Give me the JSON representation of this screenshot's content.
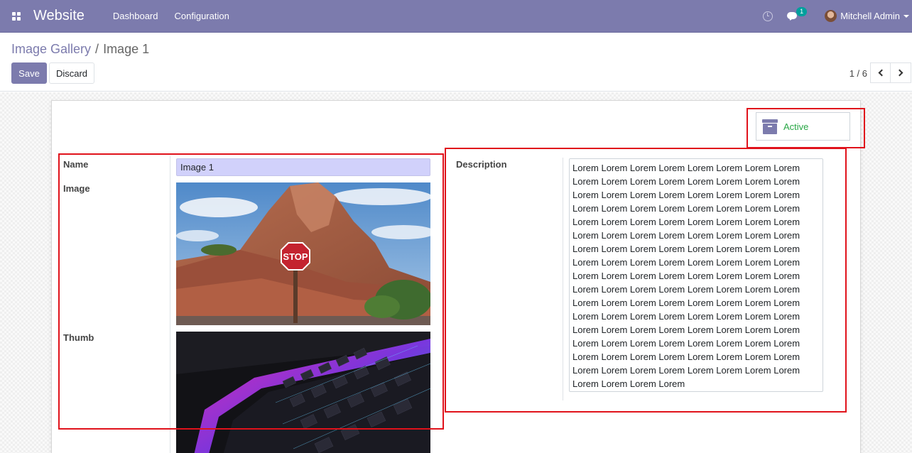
{
  "navbar": {
    "app_title": "Website",
    "menu": [
      "Dashboard",
      "Configuration"
    ],
    "message_count": "1",
    "user_name": "Mitchell Admin",
    "bg_color": "#7c7bad"
  },
  "breadcrumb": {
    "parent": "Image Gallery",
    "separator": "/",
    "current": "Image 1"
  },
  "actions": {
    "save_label": "Save",
    "discard_label": "Discard"
  },
  "pager": {
    "value": "1 / 6"
  },
  "status_button": {
    "label": "Active",
    "icon": "archive-icon"
  },
  "form": {
    "name_label": "Name",
    "name_value": "Image 1",
    "image_label": "Image",
    "thumb_label": "Thumb",
    "description_label": "Description",
    "description_value": "Lorem Lorem Lorem Lorem Lorem Lorem Lorem Lorem\nLorem Lorem Lorem Lorem Lorem Lorem Lorem Lorem\nLorem Lorem Lorem Lorem Lorem Lorem Lorem Lorem\nLorem Lorem Lorem Lorem Lorem Lorem Lorem Lorem\nLorem Lorem Lorem Lorem Lorem Lorem Lorem Lorem\nLorem Lorem Lorem Lorem Lorem Lorem Lorem Lorem\nLorem Lorem Lorem Lorem Lorem Lorem Lorem Lorem\nLorem Lorem Lorem Lorem Lorem Lorem Lorem Lorem\nLorem Lorem Lorem Lorem Lorem Lorem Lorem Lorem\nLorem Lorem Lorem Lorem Lorem Lorem Lorem Lorem\nLorem Lorem Lorem Lorem Lorem Lorem Lorem Lorem\nLorem Lorem Lorem Lorem Lorem Lorem Lorem Lorem\nLorem Lorem Lorem Lorem Lorem Lorem Lorem Lorem\nLorem Lorem Lorem Lorem Lorem Lorem Lorem Lorem\nLorem Lorem Lorem Lorem Lorem Lorem Lorem Lorem\nLorem Lorem Lorem Lorem Lorem Lorem Lorem Lorem\nLorem Lorem Lorem Lorem"
  },
  "images": {
    "image_sign": "STOP"
  }
}
